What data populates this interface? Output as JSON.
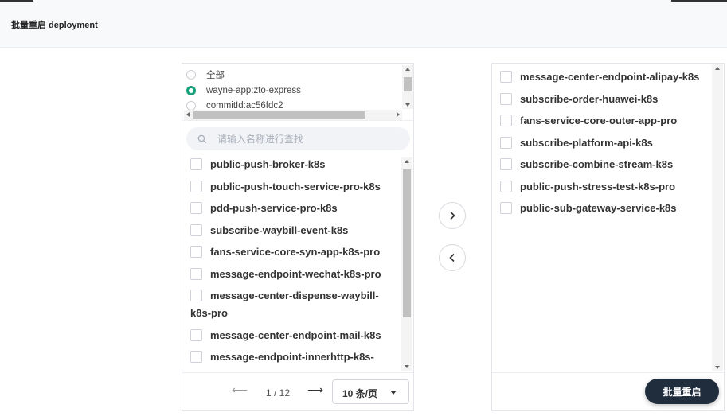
{
  "header": {
    "title": "批量重启 deployment"
  },
  "filter": {
    "options": [
      {
        "label": "全部",
        "selected": false
      },
      {
        "label": "wayne-app:zto-express",
        "selected": true
      },
      {
        "label": "commitId:ac56fdc2",
        "selected": false
      }
    ],
    "accent_color": "#12a37b"
  },
  "search": {
    "placeholder": "请输入名称进行查找",
    "value": ""
  },
  "left_list": {
    "items": [
      "public-push-broker-k8s",
      "public-push-touch-service-pro-k8s",
      "pdd-push-service-pro-k8s",
      "subscribe-waybill-event-k8s",
      "fans-service-core-syn-app-k8s-pro",
      "message-endpoint-wechat-k8s-pro",
      "message-center-dispense-waybill-k8s-pro",
      "message-center-endpoint-mail-k8s",
      "message-endpoint-innerhttp-k8s-"
    ]
  },
  "pager": {
    "text": "1 / 12",
    "page_size": "10 条/页"
  },
  "right_list": {
    "items": [
      "message-center-endpoint-alipay-k8s",
      "subscribe-order-huawei-k8s",
      "fans-service-core-outer-app-pro",
      "subscribe-platform-api-k8s",
      "subscribe-combine-stream-k8s",
      "public-push-stress-test-k8s-pro",
      "public-sub-gateway-service-k8s"
    ]
  },
  "actions": {
    "submit_label": "批量重启",
    "button_color": "#1f2d3d"
  }
}
